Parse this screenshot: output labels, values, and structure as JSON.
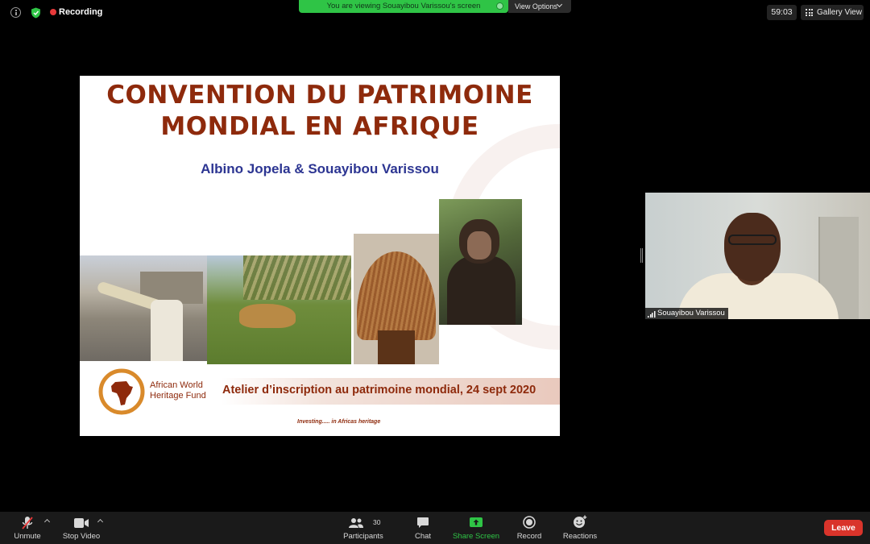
{
  "topbar": {
    "recording_label": "Recording",
    "banner_text": "You are viewing Souayibou Varissou's screen",
    "view_options_label": "View Options",
    "timer": "59:03",
    "gallery_view_label": "Gallery View"
  },
  "slide": {
    "title_line1": "CONVENTION DU PATRIMOINE",
    "title_line2": "MONDIAL EN AFRIQUE",
    "authors": "Albino Jopela & Souayibou Varissou",
    "logo_line1": "African World",
    "logo_line2": "Heritage Fund",
    "footer_text": "Atelier d’inscription au patrimoine mondial, 24 sept 2020",
    "tagline": "Investing..... in Africas heritage"
  },
  "video": {
    "participant_name": "Souayibou Varissou"
  },
  "toolbar": {
    "unmute_label": "Unmute",
    "stop_video_label": "Stop Video",
    "participants_label": "Participants",
    "participants_count": "30",
    "chat_label": "Chat",
    "share_screen_label": "Share Screen",
    "record_label": "Record",
    "reactions_label": "Reactions",
    "leave_label": "Leave"
  },
  "colors": {
    "share_green": "#2fc446",
    "leave_red": "#d9342b",
    "slide_title": "#8e2a0c",
    "slide_authors": "#2c3592",
    "recording_red": "#e8393a"
  }
}
